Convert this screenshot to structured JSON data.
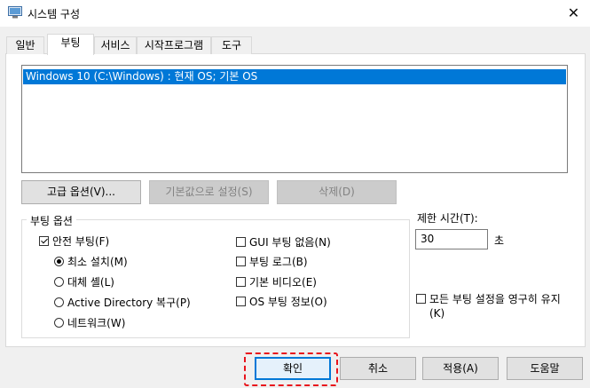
{
  "window": {
    "title": "시스템 구성",
    "close_glyph": "✕"
  },
  "tabs": [
    {
      "label": "일반"
    },
    {
      "label": "부팅",
      "active": true
    },
    {
      "label": "서비스"
    },
    {
      "label": "시작프로그램"
    },
    {
      "label": "도구"
    }
  ],
  "os_list": {
    "items": [
      "Windows 10 (C:\\Windows) : 현재 OS; 기본 OS"
    ],
    "selected_index": 0
  },
  "list_buttons": {
    "advanced": "고급 옵션(V)...",
    "set_default": "기본값으로 설정(S)",
    "delete": "삭제(D)"
  },
  "boot_options": {
    "title": "부팅 옵션",
    "safe_boot": {
      "label": "안전 부팅(F)",
      "checked": true
    },
    "minimal": {
      "label": "최소 설치(M)",
      "selected": true
    },
    "alternate_shell": {
      "label": "대체 셸(L)",
      "selected": false
    },
    "ad_repair": {
      "label": "Active Directory 복구(P)",
      "selected": false
    },
    "network": {
      "label": "네트워크(W)",
      "selected": false
    },
    "no_gui_boot": {
      "label": "GUI 부팅 없음(N)",
      "checked": false
    },
    "boot_log": {
      "label": "부팅 로그(B)",
      "checked": false
    },
    "base_video": {
      "label": "기본 비디오(E)",
      "checked": false
    },
    "os_boot_info": {
      "label": "OS 부팅 정보(O)",
      "checked": false
    }
  },
  "timeout": {
    "label": "제한 시간(T):",
    "value": "30",
    "unit": "초"
  },
  "permanent": {
    "label": "모든 부팅 설정을 영구히 유지",
    "accel": "(K)",
    "checked": false
  },
  "footer": {
    "ok": "확인",
    "cancel": "취소",
    "apply": "적용(A)",
    "help": "도움말"
  },
  "colors": {
    "selection": "#0078d7",
    "highlight": "#e8141c"
  }
}
